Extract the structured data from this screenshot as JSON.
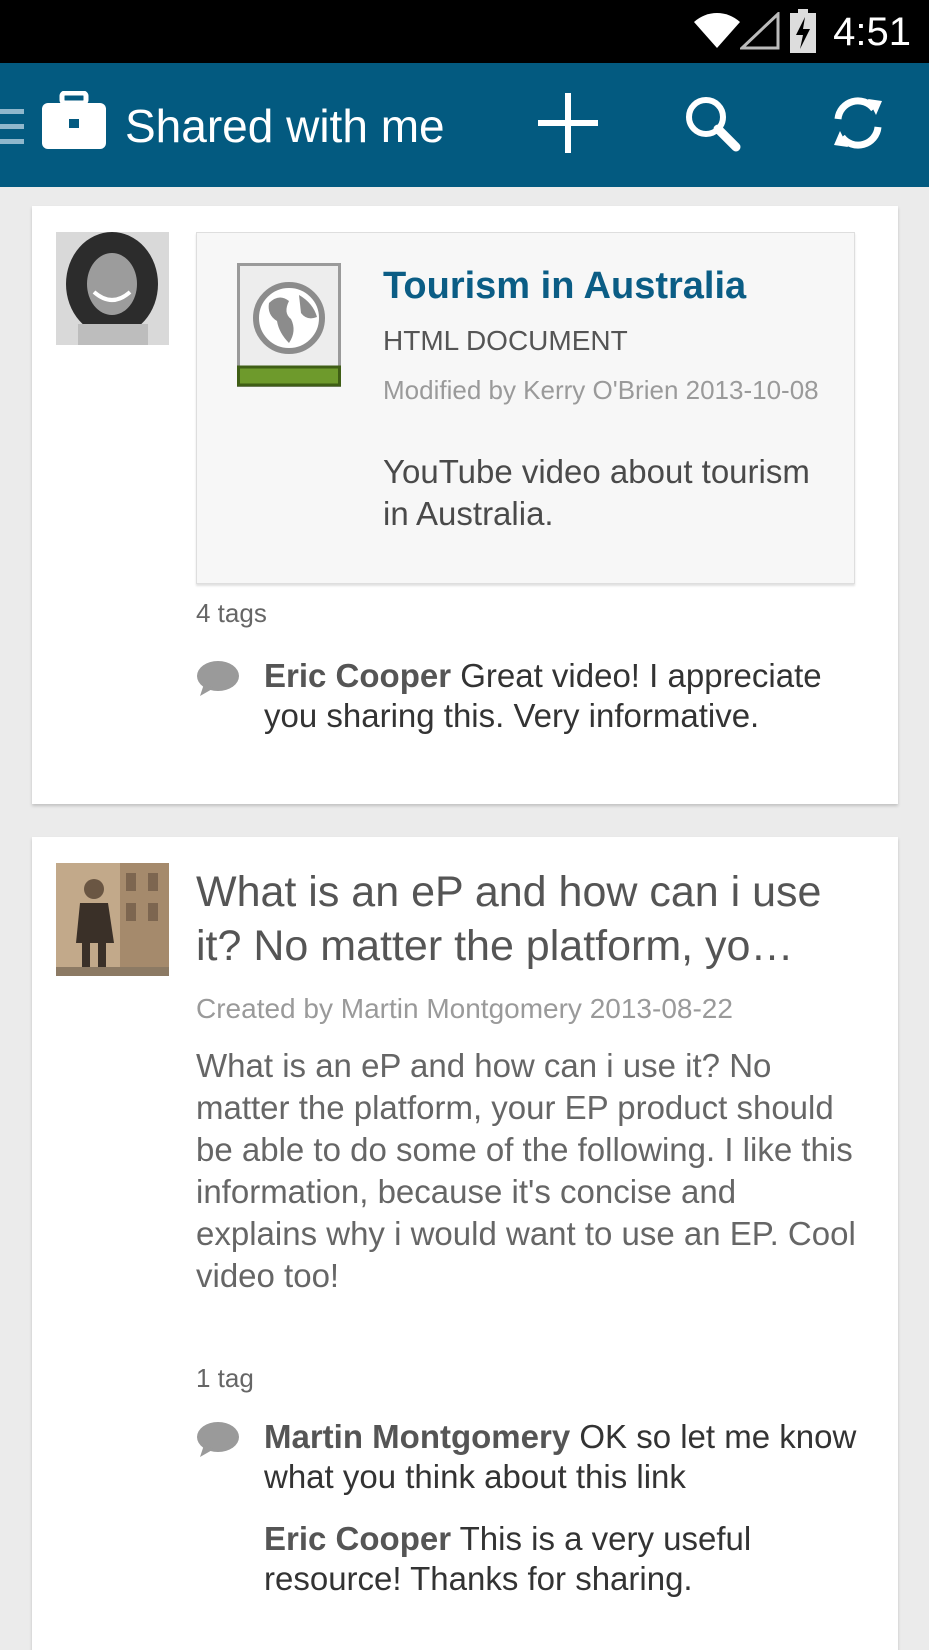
{
  "status_bar": {
    "time": "4:51",
    "icons": [
      "wifi-icon",
      "signal-icon",
      "battery-charging-icon"
    ]
  },
  "action_bar": {
    "title": "Shared with me",
    "background": "#035a80",
    "icons": [
      "menu-icon",
      "briefcase-icon",
      "add-icon",
      "search-icon",
      "refresh-icon"
    ]
  },
  "feed": {
    "items": [
      {
        "avatar": "user-avatar-woman",
        "attachment": {
          "icon": "globe-document-icon",
          "title": "Tourism in Australia",
          "type": "HTML DOCUMENT",
          "modified": "Modified by Kerry  O'Brien 2013-10-08",
          "description": "YouTube video about tourism in Australia."
        },
        "tags": "4 tags",
        "comments": [
          {
            "author": "Eric Cooper",
            "text": "Great video! I appreciate you sharing this. Very informative."
          }
        ]
      },
      {
        "avatar": "user-avatar-man",
        "title": "What is an eP and how can i use it?   No matter the platform, yo…",
        "meta": "Created by Martin Montgomery 2013-08-22",
        "body": "What is an eP and how can i use it?   No matter the platform, your EP product should be able to do some of the following.  I like this information, because it's concise and explains why i would want to use an EP.  Cool video too!",
        "tags": "1 tag",
        "comments": [
          {
            "author": "Martin Montgomery",
            "text": "OK so let me know what you think about this link"
          },
          {
            "author": "Eric Cooper",
            "text": "This is a very useful resource! Thanks for sharing."
          }
        ]
      }
    ]
  }
}
